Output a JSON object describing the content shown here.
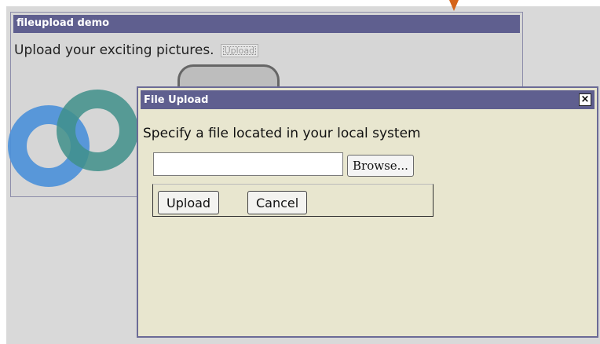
{
  "main_window": {
    "title": "fileupload demo",
    "prompt_text": "Upload your exciting pictures.",
    "upload_button_label": "Upload"
  },
  "dialog": {
    "title": "File Upload",
    "close_glyph": "×",
    "message": "Specify a file located in your local system",
    "file_input": {
      "value": "",
      "placeholder": ""
    },
    "browse_label": "Browse...",
    "upload_label": "Upload",
    "cancel_label": "Cancel"
  },
  "colors": {
    "titlebar": "#5f5f8f",
    "dialog_background": "#e8e6cf",
    "workspace": "#d9d9d9",
    "arrow": "#d4641a"
  }
}
